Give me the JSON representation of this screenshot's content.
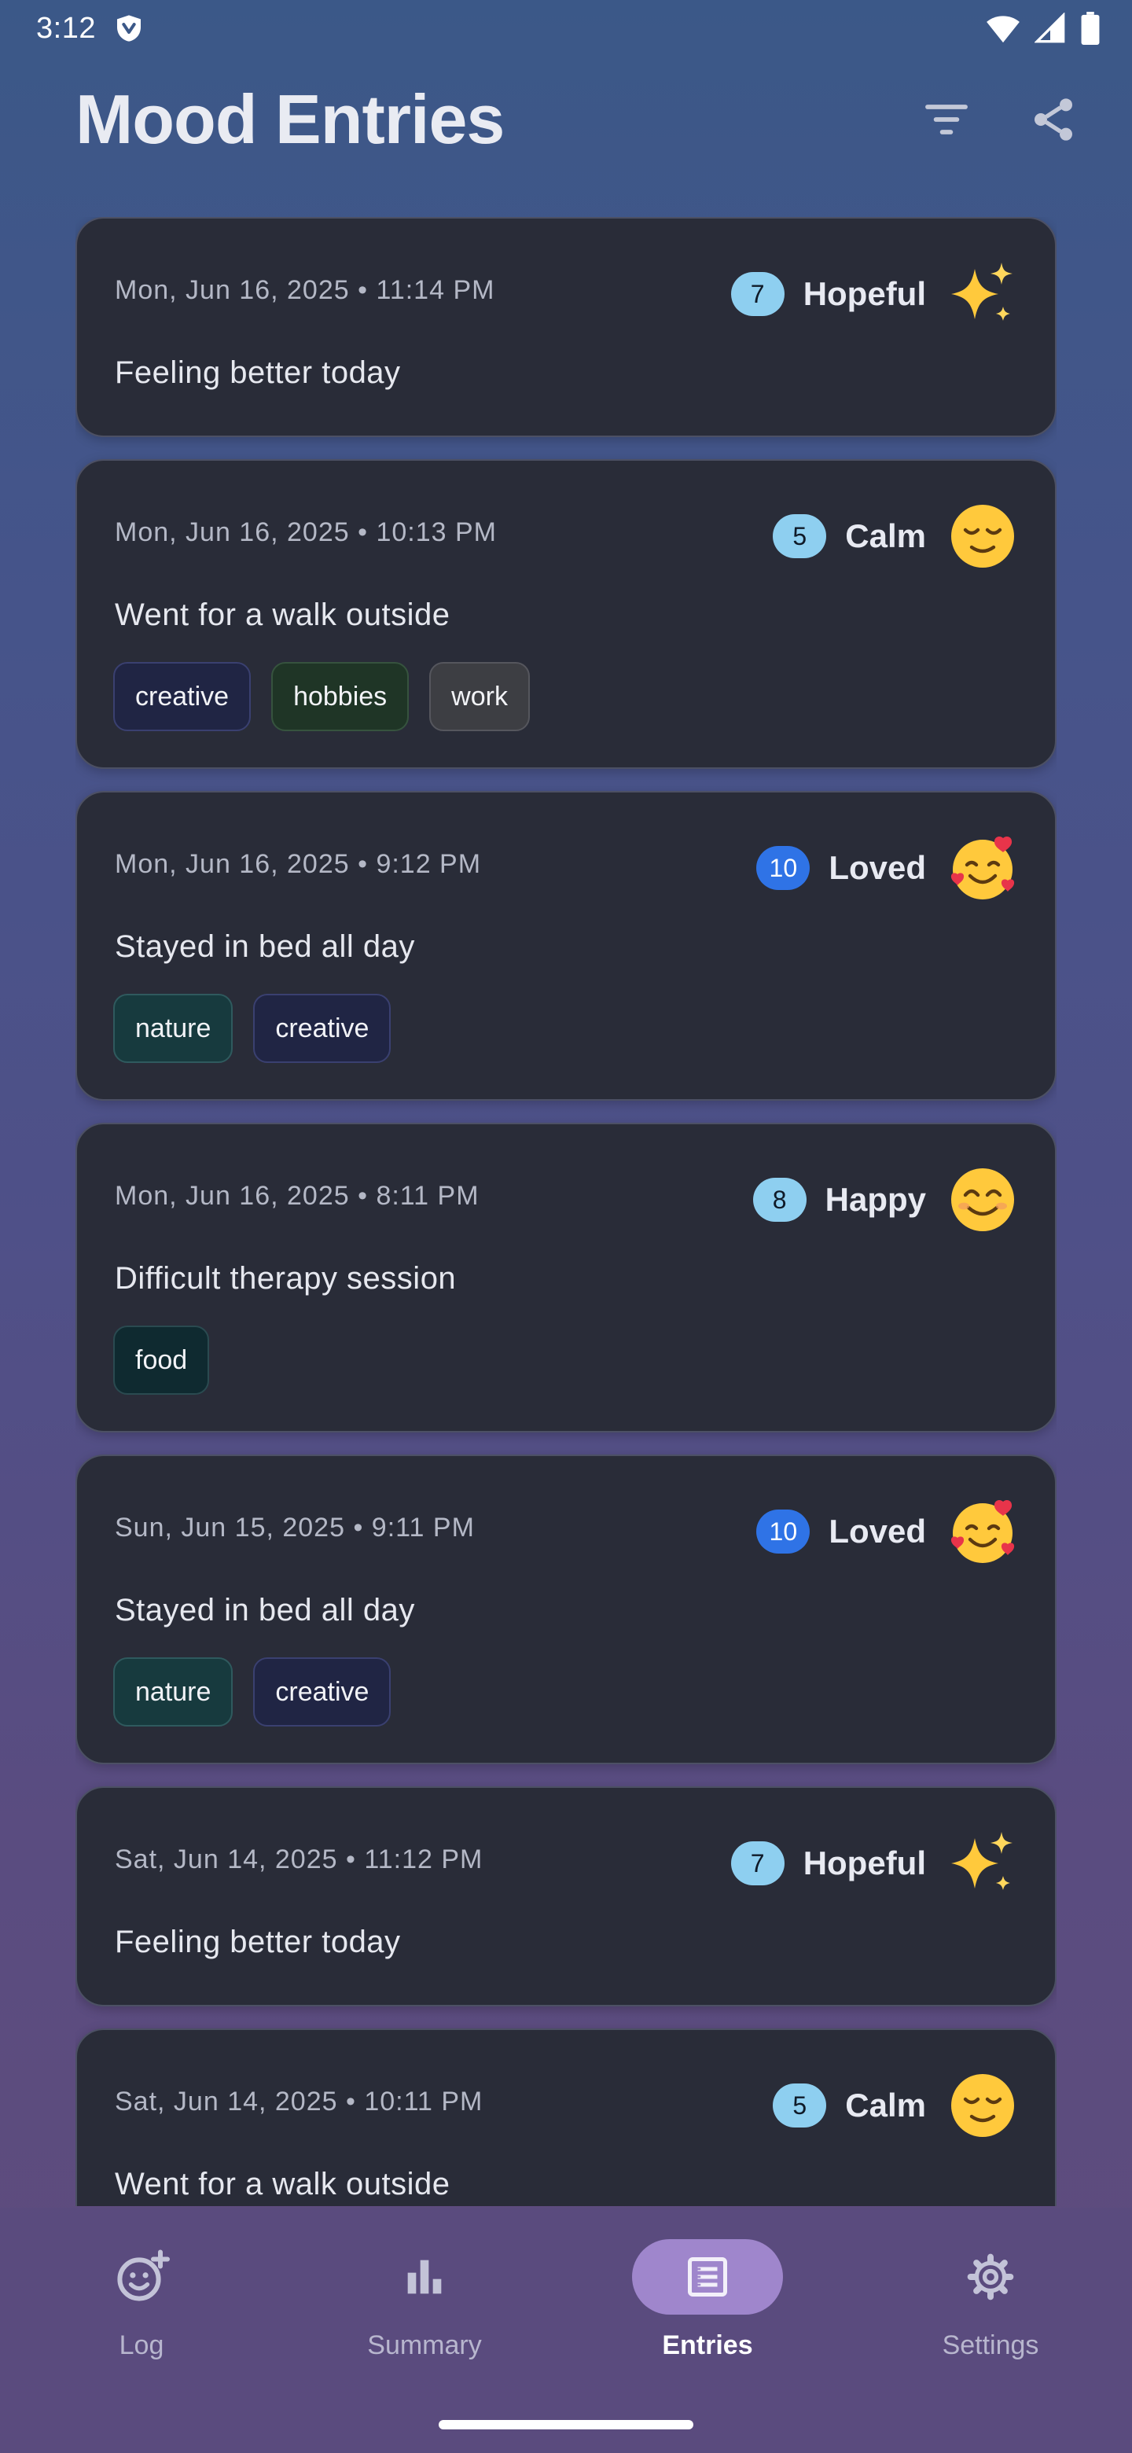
{
  "status_bar": {
    "time": "3:12"
  },
  "header": {
    "title": "Mood Entries",
    "filter_icon": "filter-icon",
    "share_icon": "share-icon"
  },
  "colors": {
    "score_light_blue": "#8ecff0",
    "score_bright_blue": "#2f73e6",
    "tag_creative": "#202544",
    "tag_hobbies": "#1f3526",
    "tag_work": "#3d3e43",
    "tag_nature": "#173a3e",
    "tag_food": "#0f2a30",
    "nav_active": "#9f86cc"
  },
  "entries": [
    {
      "date": "Mon, Jun 16, 2025 • 11:14 PM",
      "score": "7",
      "mood": "Hopeful",
      "emoji": "sparkles-icon",
      "note": "Feeling better today",
      "tags": []
    },
    {
      "date": "Mon, Jun 16, 2025 • 10:13 PM",
      "score": "5",
      "mood": "Calm",
      "emoji": "relieved-face-icon",
      "note": "Went for a walk outside",
      "tags": [
        "creative",
        "hobbies",
        "work"
      ]
    },
    {
      "date": "Mon, Jun 16, 2025 • 9:12 PM",
      "score": "10",
      "mood": "Loved",
      "emoji": "smiling-face-with-hearts-icon",
      "note": "Stayed in bed all day",
      "tags": [
        "nature",
        "creative"
      ]
    },
    {
      "date": "Mon, Jun 16, 2025 • 8:11 PM",
      "score": "8",
      "mood": "Happy",
      "emoji": "smiling-face-icon",
      "note": "Difficult therapy session",
      "tags": [
        "food"
      ]
    },
    {
      "date": "Sun, Jun 15, 2025 • 9:11 PM",
      "score": "10",
      "mood": "Loved",
      "emoji": "smiling-face-with-hearts-icon",
      "note": "Stayed in bed all day",
      "tags": [
        "nature",
        "creative"
      ]
    },
    {
      "date": "Sat, Jun 14, 2025 • 11:12 PM",
      "score": "7",
      "mood": "Hopeful",
      "emoji": "sparkles-icon",
      "note": "Feeling better today",
      "tags": []
    },
    {
      "date": "Sat, Jun 14, 2025 • 10:11 PM",
      "score": "5",
      "mood": "Calm",
      "emoji": "relieved-face-icon",
      "note": "Went for a walk outside",
      "tags": []
    }
  ],
  "bottom_nav": {
    "items": [
      {
        "label": "Log",
        "icon": "add-mood-icon",
        "active": false
      },
      {
        "label": "Summary",
        "icon": "bar-chart-icon",
        "active": false
      },
      {
        "label": "Entries",
        "icon": "list-icon",
        "active": true
      },
      {
        "label": "Settings",
        "icon": "gear-icon",
        "active": false
      }
    ]
  }
}
